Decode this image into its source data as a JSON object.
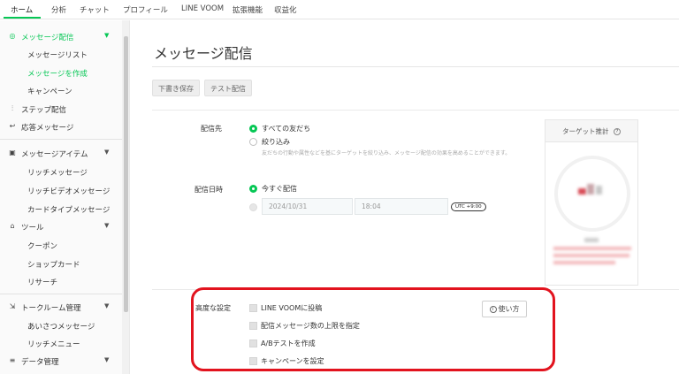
{
  "topnav": {
    "tabs": [
      "ホーム",
      "分析",
      "チャット",
      "プロフィール",
      "LINE VOOM",
      "拡張機能",
      "収益化"
    ]
  },
  "sidebar": {
    "message_section": "メッセージ配信",
    "message_list": "メッセージリスト",
    "create_message": "メッセージを作成",
    "campaign": "キャンペーン",
    "step_delivery": "ステップ配信",
    "response_message": "応答メッセージ",
    "message_items": "メッセージアイテム",
    "rich_message": "リッチメッセージ",
    "rich_video_message": "リッチビデオメッセージ",
    "card_type_message": "カードタイプメッセージ",
    "tools": "ツール",
    "coupon": "クーポン",
    "shop_card": "ショップカード",
    "research": "リサーチ",
    "talk_room": "トークルーム管理",
    "greeting_message": "あいさつメッセージ",
    "rich_menu": "リッチメニュー",
    "data_management": "データ管理"
  },
  "main": {
    "title": "メッセージ配信",
    "save_draft": "下書き保存",
    "test_delivery": "テスト配信",
    "recipient_label": "配信先",
    "all_friends": "すべての友だち",
    "narrow_down": "絞り込み",
    "narrow_hint": "友だちの行動や属性などを基にターゲットを絞り込み、メッセージ配信の効果を高めることができます。",
    "date_label": "配信日時",
    "send_now": "今すぐ配信",
    "date_value": "2024/10/31",
    "time_value": "18:04",
    "utc": "UTC +9:00",
    "target_estimate": "ターゲット推計",
    "advanced_label": "高度な設定",
    "opt_voom": "LINE VOOMに投稿",
    "opt_limit": "配信メッセージ数の上限を指定",
    "opt_ab": "A/Bテストを作成",
    "opt_campaign": "キャンペーンを設定",
    "howto": "使い方"
  },
  "colors": {
    "brand_green": "#06c755",
    "highlight_red": "#e2131e"
  }
}
